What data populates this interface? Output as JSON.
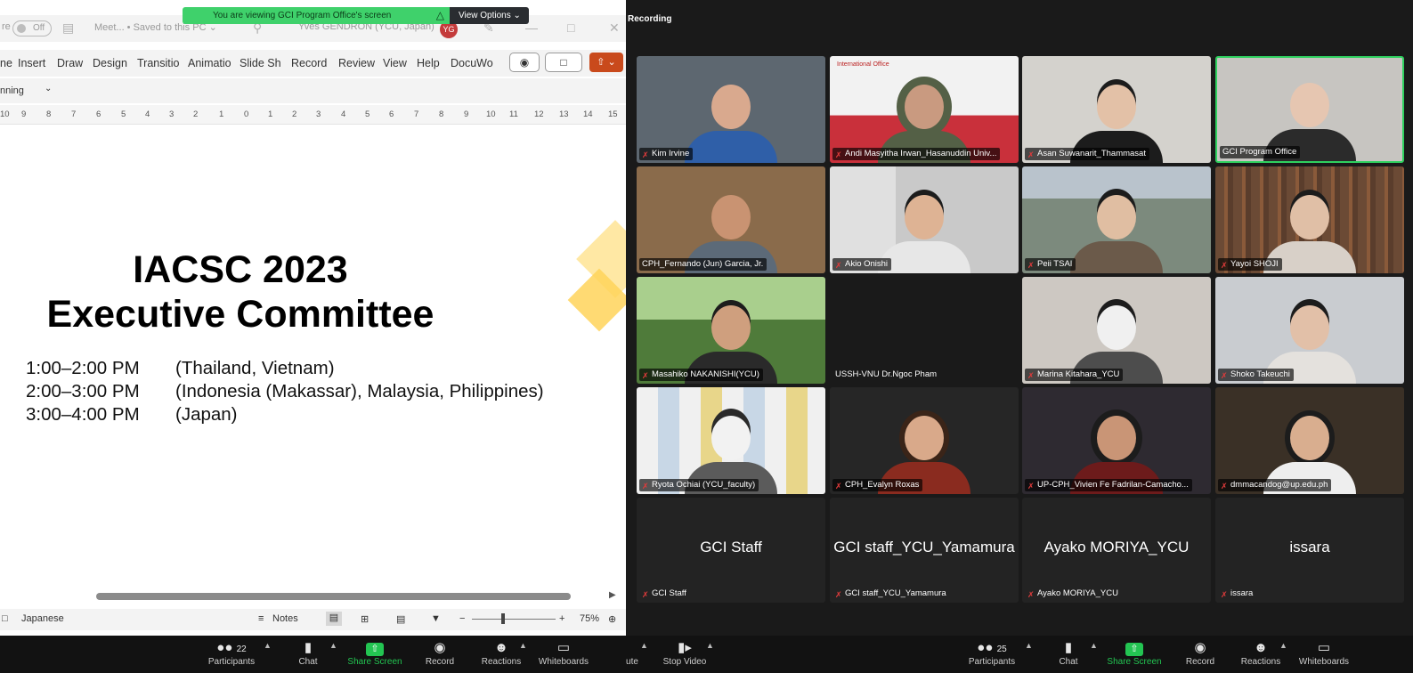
{
  "banner": {
    "text": "You are viewing GCI Program Office's screen",
    "view_options": "View Options ⌄"
  },
  "recording_label": "Recording",
  "ppt": {
    "autosave": "Off",
    "doc_title": "Meet...  •  Saved to this PC ⌄",
    "user_name": "Yves GENDRON (YCU, Japan)",
    "user_initials": "YG",
    "tabs": [
      "ne",
      "Insert",
      "Draw",
      "Design",
      "Transitio",
      "Animatio",
      "Slide Sh",
      "Record",
      "Review",
      "View",
      "Help",
      "DocuWo"
    ],
    "subbar_text": "nning",
    "ruler": [
      "10",
      "9",
      "8",
      "7",
      "6",
      "5",
      "4",
      "3",
      "2",
      "1",
      "0",
      "1",
      "2",
      "3",
      "4",
      "5",
      "6",
      "7",
      "8",
      "9",
      "10",
      "11",
      "12",
      "13",
      "14",
      "15"
    ],
    "slide": {
      "title_line1": "IACSC 2023",
      "title_line2": "Executive Committee",
      "schedule": [
        {
          "time": "1:00–2:00 PM",
          "desc": "(Thailand, Vietnam)"
        },
        {
          "time": "2:00–3:00 PM",
          "desc": "(Indonesia (Makassar), Malaysia, Philippines)"
        },
        {
          "time": "3:00–4:00 PM",
          "desc": "(Japan)"
        }
      ]
    },
    "status": {
      "language": "Japanese",
      "notes": "Notes",
      "zoom": "75%"
    }
  },
  "participants_tiles": [
    {
      "name": "Kim Irvine",
      "bg": "#5d6770",
      "skin": "#d9a98e",
      "shirt": "#2f5fa8"
    },
    {
      "name": "Andi Masyitha Irwan_Hasanuddin Univ...",
      "bg": "#c9303b",
      "skin": "#c99a80",
      "shirt": "#546046",
      "logo": "International Office"
    },
    {
      "name": "Asan Suwanarit_Thammasat",
      "bg": "#d4d2cd",
      "skin": "#e3c1a7",
      "shirt": "#1c1c1c"
    },
    {
      "name": "GCI Program Office",
      "bg": "#c7c5c1",
      "skin": "#e6c6b1",
      "shirt": "#2b2b2b"
    },
    {
      "name": "CPH_Fernando (Jun) Garcia, Jr.",
      "bg": "#8a6b4b",
      "skin": "#c99372",
      "shirt": "#5c6a78"
    },
    {
      "name": "Akio Onishi",
      "bg": "#c9c9c9",
      "skin": "#deb394",
      "shirt": "#e7e7e7"
    },
    {
      "name": "Peii TSAI",
      "bg": "#7c8a7d",
      "skin": "#e0bea2",
      "shirt": "#6b5a4a"
    },
    {
      "name": "Yayoi SHOJI",
      "bg": "#6b4a35",
      "skin": "#e0bfa6",
      "shirt": "#d8d0c8"
    },
    {
      "name": "Masahiko NAKANISHI(YCU)",
      "bg": "#4f7b3a",
      "skin": "#cf9f7e",
      "shirt": "#2a2a2a"
    },
    {
      "name": "USSH-VNU Dr.Ngoc Pham",
      "bg": "#1f1f1f"
    },
    {
      "name": "Marina Kitahara_YCU",
      "bg": "#cdc8c2",
      "skin": "#f0f0f0",
      "shirt": "#4d4d4d"
    },
    {
      "name": "Shoko Takeuchi",
      "bg": "#c9ccd0",
      "skin": "#e2c0a8",
      "shirt": "#e4e1dd"
    },
    {
      "name": "Ryota Ochiai (YCU_faculty)",
      "bg": "#d6d6d6",
      "skin": "#f2f2f2",
      "shirt": "#5b5b5b"
    },
    {
      "name": "CPH_Evalyn Roxas",
      "bg": "#262626",
      "skin": "#d9a98a",
      "shirt": "#8a2b1f"
    },
    {
      "name": "UP-CPH_Vivien Fe Fadrilan-Camacho...",
      "bg": "#2e2a31",
      "skin": "#c99576",
      "shirt": "#6d1b1b"
    },
    {
      "name": "dmmacandog@up.edu.ph",
      "bg": "#3a3026",
      "skin": "#d9ae8f",
      "shirt": "#eeeeee"
    },
    {
      "name": "GCI Staff",
      "label": "GCI Staff"
    },
    {
      "name": "GCI staff_YCU_Yamamura",
      "label": "GCI staff_YCU_Yamamura"
    },
    {
      "name": "Ayako MORIYA_YCU",
      "label": "Ayako MORIYA_YCU"
    },
    {
      "name": "issara",
      "label": "issara"
    }
  ],
  "toolbar_left": {
    "participants_count": "22",
    "participants": "Participants",
    "chat": "Chat",
    "share": "Share Screen",
    "record": "Record",
    "reactions": "Reactions",
    "whiteboards": "Whiteboards"
  },
  "toolbar_right": {
    "mute_fragment": "ute",
    "stop_video": "Stop Video",
    "participants_count": "25",
    "participants": "Participants",
    "chat": "Chat",
    "share": "Share Screen",
    "record": "Record",
    "reactions": "Reactions",
    "whiteboards": "Whiteboards"
  }
}
